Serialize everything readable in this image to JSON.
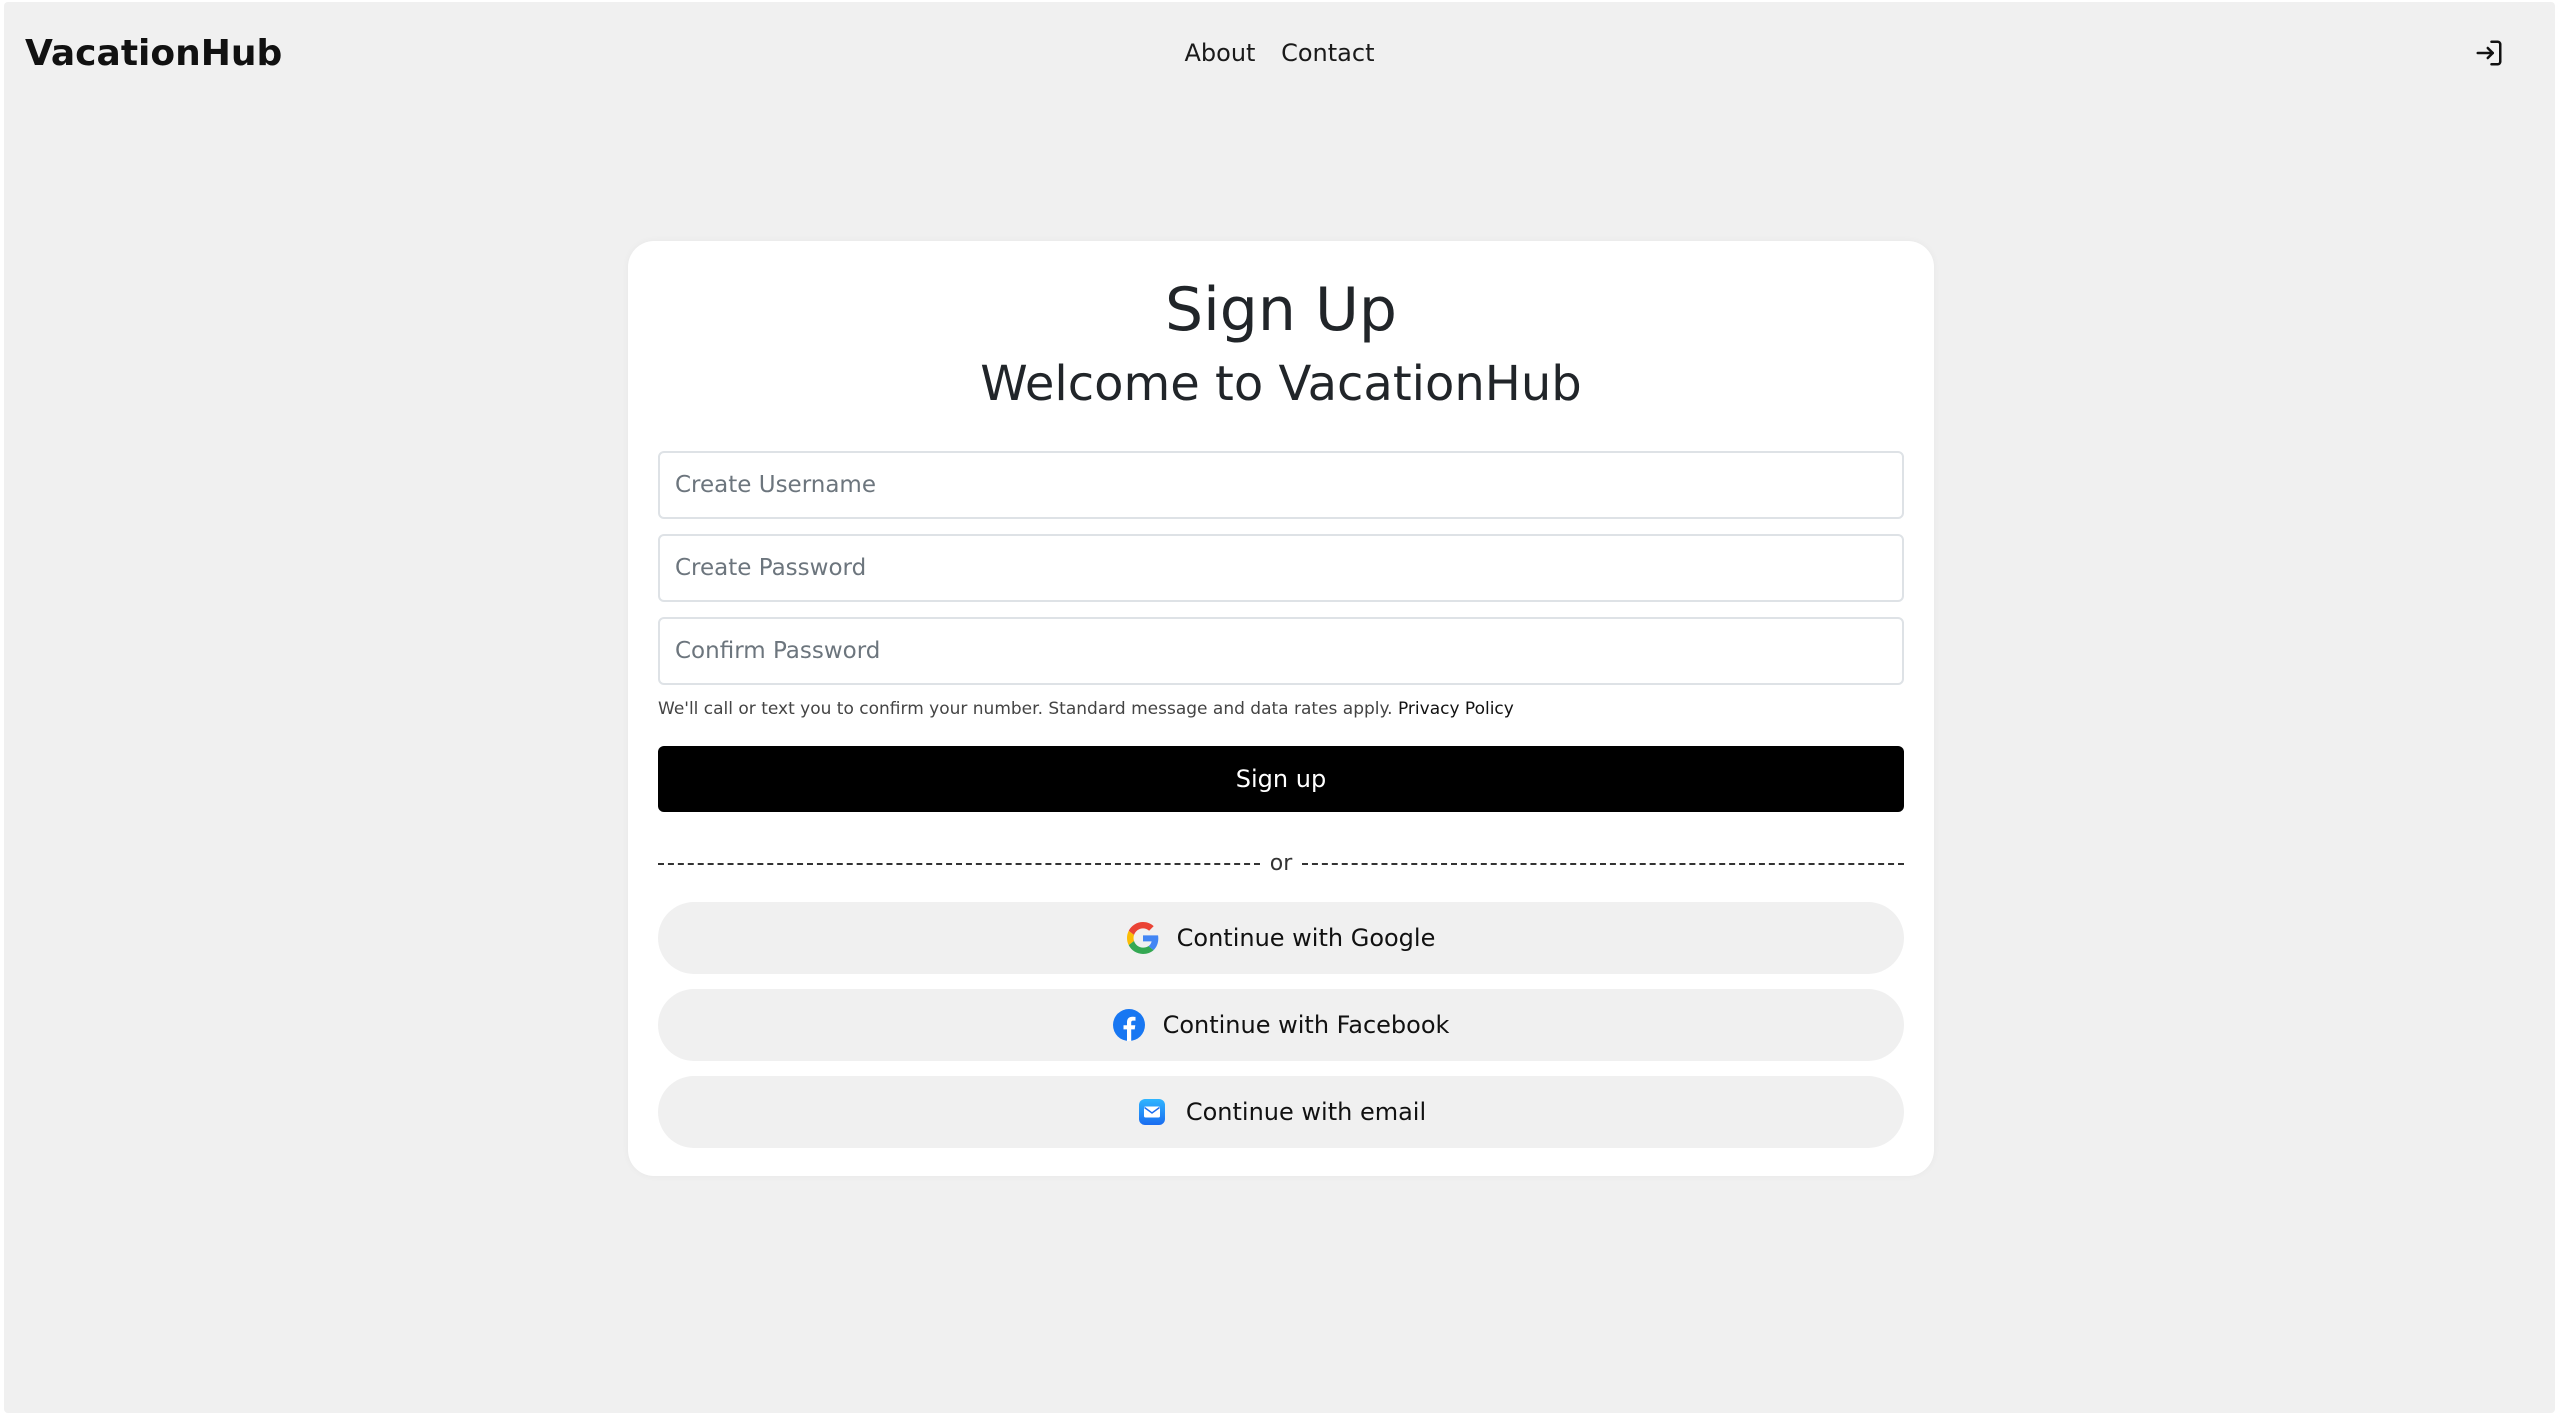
{
  "header": {
    "brand": "VacationHub",
    "nav": [
      "About",
      "Contact"
    ],
    "login_icon": "login-icon"
  },
  "card": {
    "title": "Sign Up",
    "subtitle": "Welcome to VacationHub",
    "fields": [
      {
        "placeholder": "Create Username",
        "value": ""
      },
      {
        "placeholder": "Create Password",
        "value": ""
      },
      {
        "placeholder": "Confirm Password",
        "value": ""
      }
    ],
    "help_text": "We'll call or text you to confirm your number. Standard message and data rates apply.",
    "privacy_link": "Privacy Policy",
    "signup_label": "Sign up",
    "divider_text": "or",
    "social": [
      {
        "label": "Continue with Google",
        "icon": "google-icon"
      },
      {
        "label": "Continue with Facebook",
        "icon": "facebook-icon"
      },
      {
        "label": "Continue with email",
        "icon": "email-icon"
      }
    ]
  },
  "colors": {
    "background": "#f0f0f0",
    "card": "#ffffff",
    "primary_button": "#000000",
    "facebook_blue": "#1877f2"
  }
}
